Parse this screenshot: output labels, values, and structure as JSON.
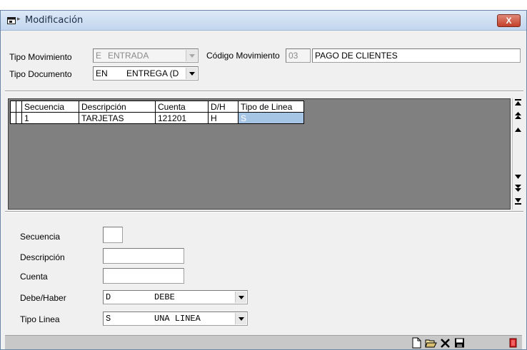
{
  "window": {
    "title": "Modificación",
    "close_label": "X"
  },
  "header": {
    "tipo_movimiento_label": "Tipo Movimiento",
    "tipo_movimiento_code": "E",
    "tipo_movimiento_value": "ENTRADA",
    "codigo_movimiento_label": "Código Movimiento",
    "codigo_movimiento_code": "03",
    "codigo_movimiento_desc": "PAGO DE CLIENTES",
    "tipo_documento_label": "Tipo Documento",
    "tipo_documento_code": "EN",
    "tipo_documento_value": "ENTREGA (D"
  },
  "grid": {
    "columns": [
      "Secuencia",
      "Descripción",
      "Cuenta",
      "D/H",
      "Tipo de Linea"
    ],
    "rows": [
      {
        "secuencia": "1",
        "descripcion": "TARJETAS",
        "cuenta": "121201",
        "dh": "H",
        "tipo_linea": "S"
      }
    ]
  },
  "form": {
    "secuencia_label": "Secuencia",
    "descripcion_label": "Descripción",
    "cuenta_label": "Cuenta",
    "debe_haber_label": "Debe/Haber",
    "debe_haber_code": "D",
    "debe_haber_value": "DEBE",
    "tipo_linea_label": "Tipo Linea",
    "tipo_linea_code": "S",
    "tipo_linea_value": "UNA LINEA"
  },
  "icons": {
    "title": "window-icon",
    "toolbar": [
      "new-document-icon",
      "open-folder-icon",
      "delete-icon",
      "save-icon",
      "exit-icon"
    ]
  }
}
